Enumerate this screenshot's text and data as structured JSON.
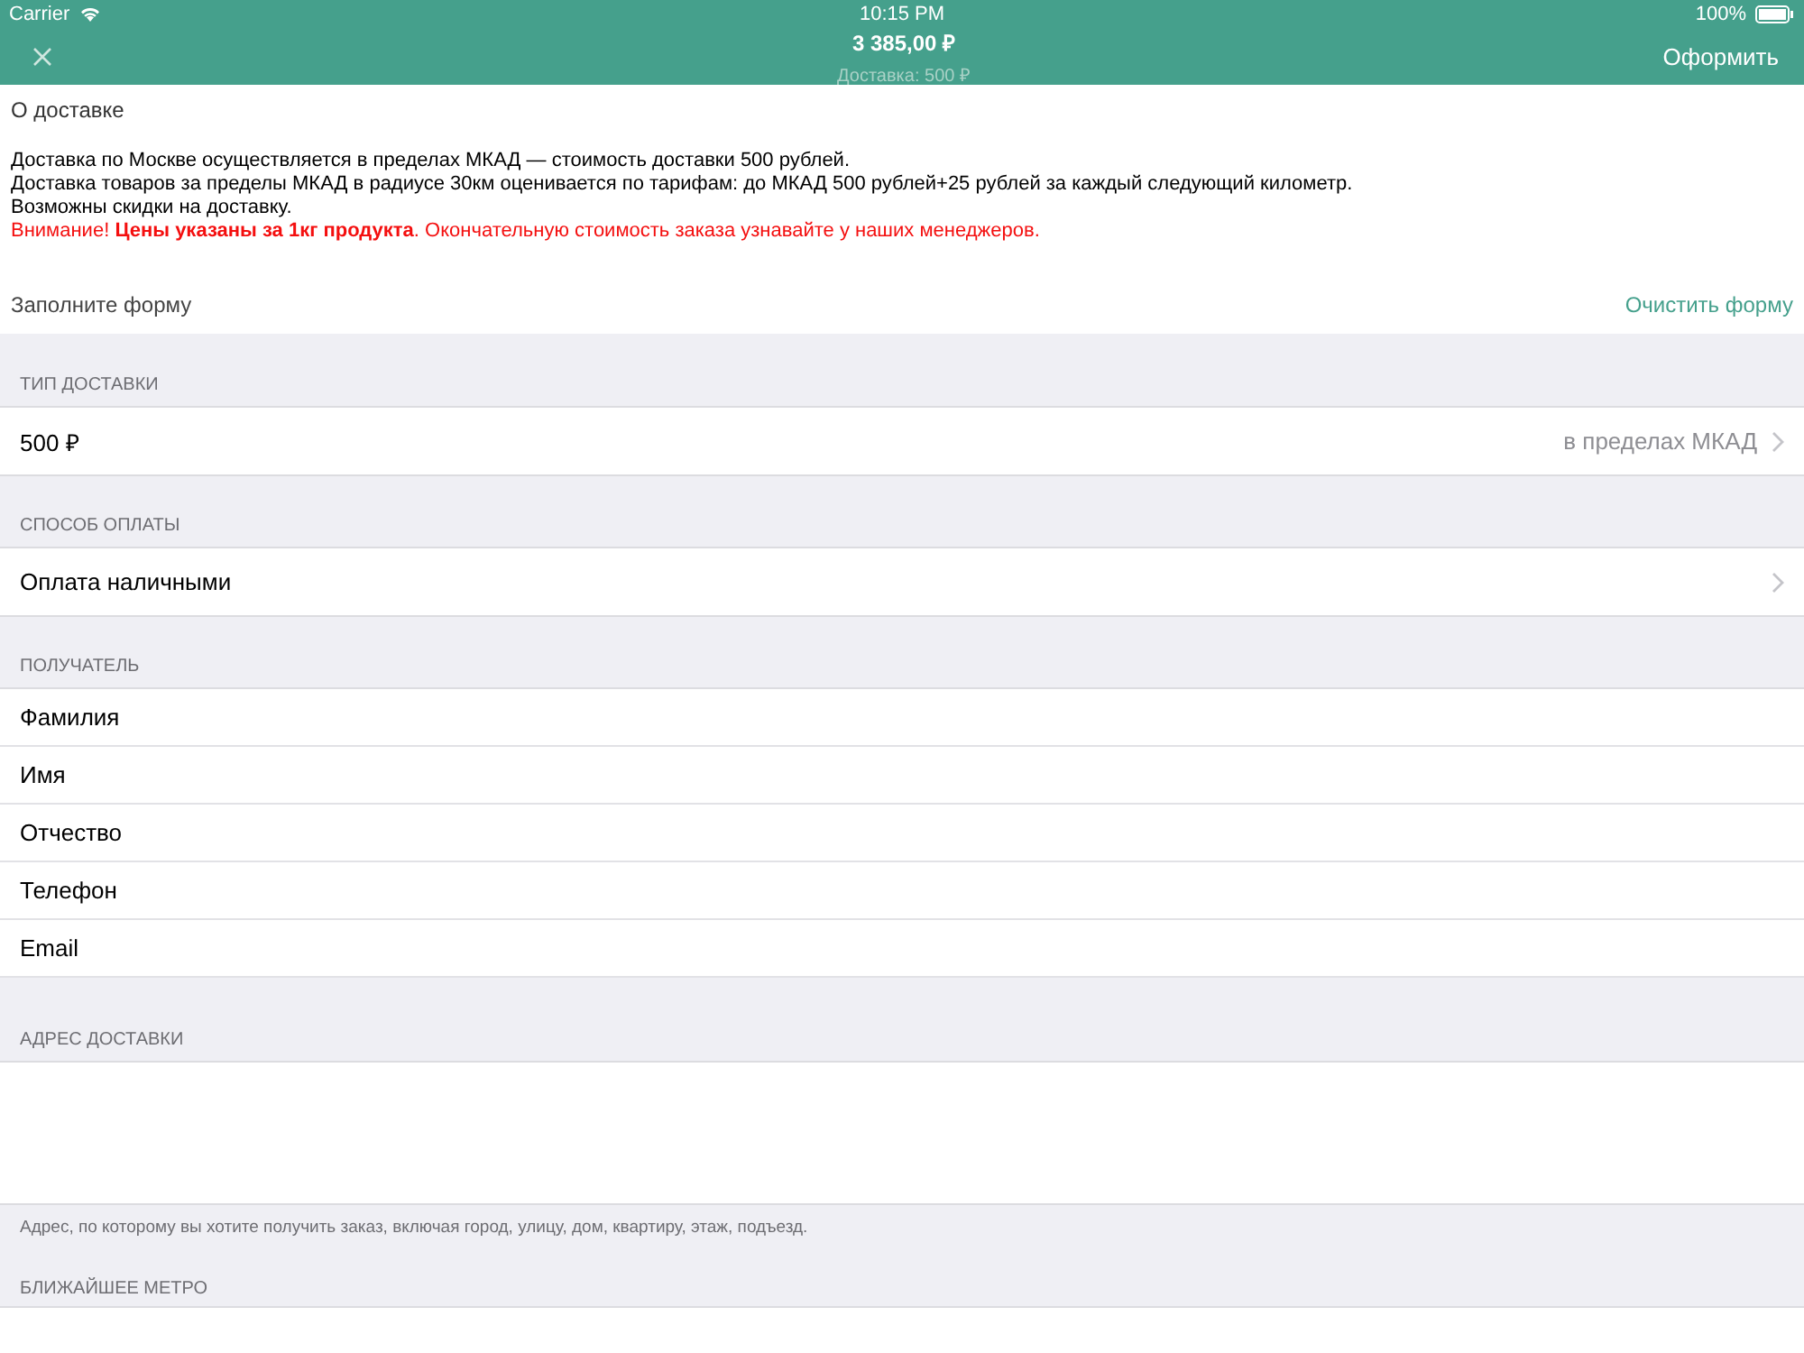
{
  "status_bar": {
    "carrier": "Carrier",
    "time": "10:15 PM",
    "battery": "100%"
  },
  "nav": {
    "total": "3 385,00 ₽",
    "subtitle": "Доставка: 500 ₽",
    "action": "Оформить"
  },
  "info": {
    "title": "О доставке",
    "lines": [
      {
        "kind": "plain",
        "text": "Доставка по Москве осуществляется в пределах МКАД — стоимость доставки 500 рублей."
      },
      {
        "kind": "plain",
        "text": "Доставка товаров за пределы МКАД в радиусе 30км оценивается по тарифам: до МКАД 500 рублей+25 рублей за каждый следующий километр."
      },
      {
        "kind": "plain",
        "text": "Возможны скидки на доставку."
      },
      {
        "kind": "warning",
        "text": "Внимание! **Цены указаны за 1кг продукта**. Окончательную стоимость заказа узнавайте у наших менеджеров."
      }
    ]
  },
  "form_header": {
    "title": "Заполните форму",
    "clear": "Очистить форму"
  },
  "sections": [
    {
      "kind": "select",
      "header": "ТИП ДОСТАВКИ",
      "label": "500 ₽",
      "value": "в пределах МКАД"
    },
    {
      "kind": "select",
      "header": "СПОСОБ ОПЛАТЫ",
      "label": "Оплата наличными"
    },
    {
      "kind": "fields",
      "header": "ПОЛУЧАТЕЛЬ",
      "fields": [
        "Фамилия",
        "Имя",
        "Отчество",
        "Телефон",
        "Email"
      ]
    },
    {
      "kind": "textarea",
      "header": "АДРЕС ДОСТАВКИ",
      "footer": "Адрес, по которому вы хотите получить заказ, включая город, улицу, дом, квартиру, этаж, подъезд."
    },
    {
      "kind": "header_only",
      "header": "БЛИЖАЙШЕЕ МЕТРО"
    }
  ]
}
